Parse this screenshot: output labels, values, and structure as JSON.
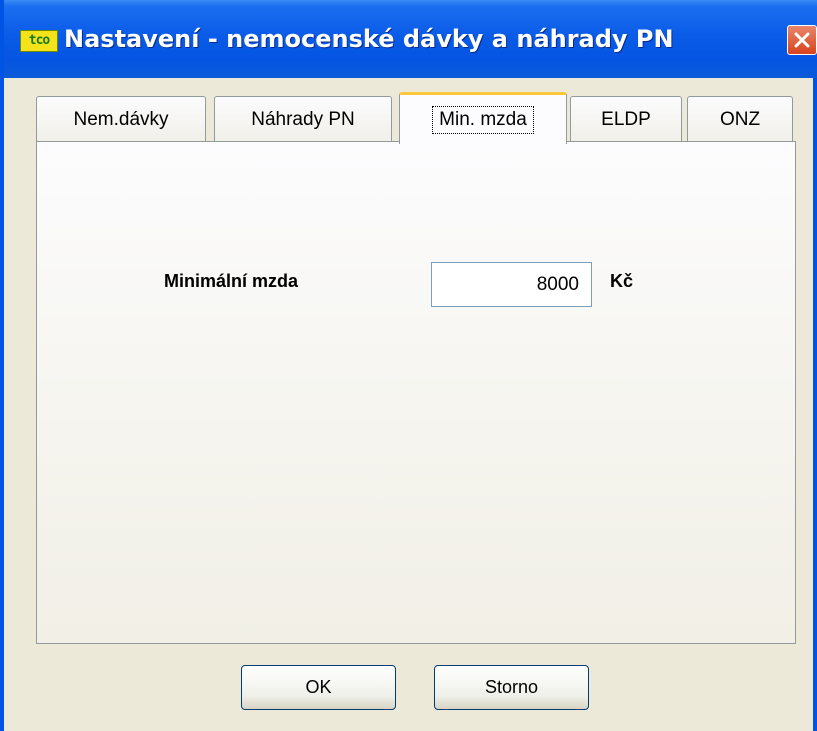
{
  "window": {
    "title": "Nastavení - nemocenské dávky a náhrady PN",
    "icon_text": "tco",
    "close_icon": "close-icon"
  },
  "tabs": [
    {
      "label": "Nem.dávky",
      "active": false
    },
    {
      "label": "Náhrady PN",
      "active": false
    },
    {
      "label": "Min. mzda",
      "active": true
    },
    {
      "label": "ELDP",
      "active": false
    },
    {
      "label": "ONZ",
      "active": false
    }
  ],
  "content": {
    "min_wage_label": "Minimální mzda",
    "min_wage_value": "8000",
    "currency": "Kč"
  },
  "buttons": {
    "ok": "OK",
    "cancel": "Storno"
  },
  "colors": {
    "titlebar": "#0554e3",
    "active_tab_accent": "#ffc83c",
    "close_button": "#d8431c"
  }
}
